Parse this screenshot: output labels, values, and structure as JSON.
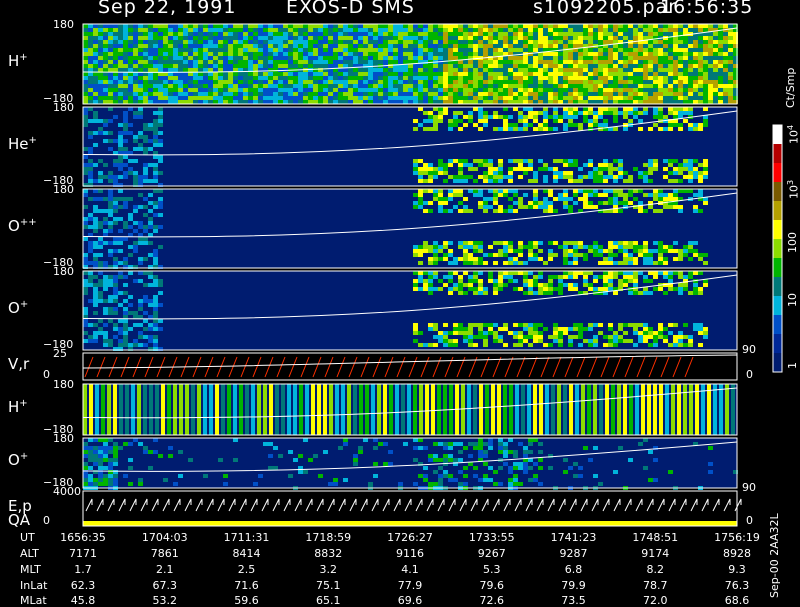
{
  "header": {
    "date": "Sep 22, 1991",
    "instrument": "EXOS-D SMS",
    "file": "s1092205.par",
    "time": "16:56:35"
  },
  "panels": [
    {
      "id": "h1",
      "label": "H",
      "sup": "+",
      "top": "180",
      "bottom": "−180",
      "style": "dense"
    },
    {
      "id": "he",
      "label": "He",
      "sup": "+",
      "top": "180",
      "bottom": "−180",
      "style": "stripes"
    },
    {
      "id": "opp",
      "label": "O",
      "sup": "++",
      "top": "180",
      "bottom": "−180",
      "style": "stripes"
    },
    {
      "id": "o1",
      "label": "O",
      "sup": "+",
      "top": "180",
      "bottom": "−180",
      "style": "stripes"
    },
    {
      "id": "vr",
      "label": "V,r",
      "sup": "",
      "top": "25",
      "bottom": "0",
      "right_top": "90",
      "right_bottom": "0",
      "style": "sawtooth"
    },
    {
      "id": "h2",
      "label": "H",
      "sup": "+",
      "top": "180",
      "bottom": "−180",
      "style": "columns"
    },
    {
      "id": "o2",
      "label": "O",
      "sup": "+",
      "top": "180",
      "bottom": "−180",
      "style": "sparse"
    },
    {
      "id": "ep",
      "label": "E,p",
      "label2": "QA",
      "sup": "",
      "top": "4000",
      "bottom": "0",
      "right_top": "90",
      "right_bottom": "0",
      "style": "epqa"
    }
  ],
  "colorbar": {
    "unit": "Ct/Smp",
    "ticks": [
      {
        "label": "10",
        "sup": "4",
        "frac": 0.03
      },
      {
        "label": "10",
        "sup": "3",
        "frac": 0.25
      },
      {
        "label": "100",
        "sup": "",
        "frac": 0.47
      },
      {
        "label": "10",
        "sup": "",
        "frac": 0.69
      },
      {
        "label": "1",
        "sup": "",
        "frac": 0.94
      }
    ],
    "colors": [
      "#ffffff",
      "#b40000",
      "#ff0000",
      "#7a5a00",
      "#b4a000",
      "#ffff00",
      "#8cdc00",
      "#00b400",
      "#007878",
      "#00b4dc",
      "#0050c8",
      "#002898",
      "#001c70"
    ]
  },
  "chart_data": {
    "type": "heatmap",
    "title": "Sep 22, 1991 EXOS-D SMS",
    "series": [
      {
        "name": "H+",
        "yrange": [
          -180,
          180
        ]
      },
      {
        "name": "He+",
        "yrange": [
          -180,
          180
        ]
      },
      {
        "name": "O++",
        "yrange": [
          -180,
          180
        ]
      },
      {
        "name": "O+",
        "yrange": [
          -180,
          180
        ]
      },
      {
        "name": "V,r",
        "yrange": [
          0,
          25
        ]
      },
      {
        "name": "H+",
        "yrange": [
          -180,
          180
        ]
      },
      {
        "name": "O+",
        "yrange": [
          -180,
          180
        ]
      },
      {
        "name": "E,p",
        "yrange": [
          0,
          4000
        ]
      }
    ],
    "ephemeris": {
      "labels": [
        "UT",
        "ALT",
        "MLT",
        "InLat",
        "MLat"
      ],
      "columns": [
        [
          "1656:35",
          "7171",
          "1.7",
          "62.3",
          "45.8"
        ],
        [
          "1704:03",
          "7861",
          "2.1",
          "67.3",
          "53.2"
        ],
        [
          "1711:31",
          "8414",
          "2.5",
          "71.6",
          "59.6"
        ],
        [
          "1718:59",
          "8832",
          "3.2",
          "75.1",
          "65.1"
        ],
        [
          "1726:27",
          "9116",
          "4.1",
          "77.9",
          "69.6"
        ],
        [
          "1733:55",
          "9267",
          "5.3",
          "79.6",
          "72.6"
        ],
        [
          "1741:23",
          "9287",
          "6.8",
          "79.9",
          "73.5"
        ],
        [
          "1748:51",
          "9174",
          "8.2",
          "78.7",
          "72.0"
        ],
        [
          "1756:19",
          "8928",
          "9.3",
          "76.3",
          "68.6"
        ]
      ]
    }
  },
  "side_text": "Sep-00 2AA32L"
}
